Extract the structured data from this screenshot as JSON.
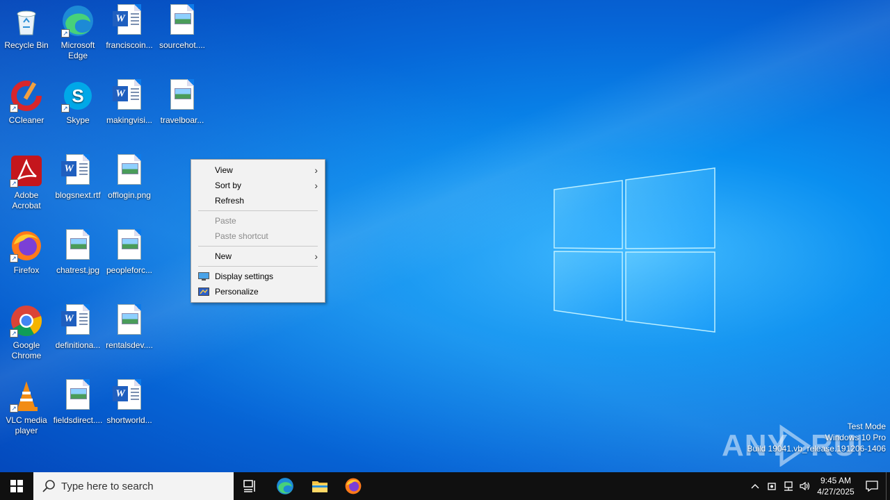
{
  "desktop": {
    "icons": [
      {
        "label": "Recycle Bin",
        "icon": "recycle-bin-icon"
      },
      {
        "label": "Microsoft Edge",
        "icon": "edge-icon"
      },
      {
        "label": "franciscoin...",
        "icon": "word-doc-icon"
      },
      {
        "label": "sourcehot....",
        "icon": "image-file-icon"
      },
      {
        "label": "CCleaner",
        "icon": "ccleaner-icon"
      },
      {
        "label": "Skype",
        "icon": "skype-icon"
      },
      {
        "label": "makingvisi...",
        "icon": "word-doc-icon"
      },
      {
        "label": "travelboar...",
        "icon": "image-file-icon"
      },
      {
        "label": "Adobe Acrobat",
        "icon": "acrobat-icon"
      },
      {
        "label": "blogsnext.rtf",
        "icon": "word-doc-icon"
      },
      {
        "label": "offlogin.png",
        "icon": "image-file-icon"
      },
      {
        "label": "Firefox",
        "icon": "firefox-icon"
      },
      {
        "label": "chatrest.jpg",
        "icon": "image-file-icon"
      },
      {
        "label": "peopleforc...",
        "icon": "image-file-icon"
      },
      {
        "label": "Google Chrome",
        "icon": "chrome-icon"
      },
      {
        "label": "definitiona...",
        "icon": "word-doc-icon"
      },
      {
        "label": "rentalsdev....",
        "icon": "image-file-icon"
      },
      {
        "label": "VLC media player",
        "icon": "vlc-icon"
      },
      {
        "label": "fieldsdirect....",
        "icon": "image-file-icon"
      },
      {
        "label": "shortworld...",
        "icon": "word-doc-icon"
      }
    ]
  },
  "context_menu": {
    "items": [
      {
        "label": "View",
        "submenu": true,
        "disabled": false
      },
      {
        "label": "Sort by",
        "submenu": true,
        "disabled": false
      },
      {
        "label": "Refresh",
        "submenu": false,
        "disabled": false
      },
      {
        "label": "Paste",
        "submenu": false,
        "disabled": true
      },
      {
        "label": "Paste shortcut",
        "submenu": false,
        "disabled": true
      },
      {
        "label": "New",
        "submenu": true,
        "disabled": false
      },
      {
        "label": "Display settings",
        "submenu": false,
        "disabled": false,
        "icon": "display-icon"
      },
      {
        "label": "Personalize",
        "submenu": false,
        "disabled": false,
        "icon": "personalize-icon"
      }
    ]
  },
  "watermark": {
    "brand": "ANY RUN",
    "line1": "Test Mode",
    "line2": "Windows 10 Pro",
    "line3": "Build 19041.vb_release.191206-1406"
  },
  "taskbar": {
    "search_placeholder": "Type here to search",
    "time": "9:45 AM",
    "date": "4/27/2025",
    "pinned": [
      "task-view-icon",
      "edge-icon",
      "file-explorer-icon",
      "firefox-icon"
    ]
  },
  "colors": {
    "taskbar_bg": "#101010",
    "menu_bg": "#f2f2f2",
    "accent": "#0a8ff0"
  }
}
